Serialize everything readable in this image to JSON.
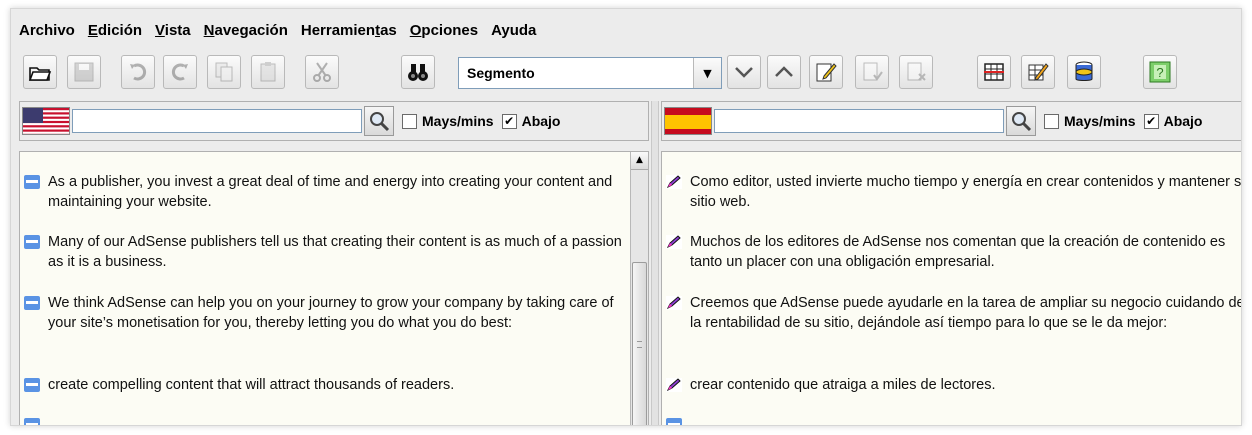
{
  "menu": [
    {
      "label": "Archivo",
      "mnemonic": ""
    },
    {
      "label": "Edición",
      "mnemonic": "E"
    },
    {
      "label": "Vista",
      "mnemonic": "V"
    },
    {
      "label": "Navegación",
      "mnemonic": "N"
    },
    {
      "label": "Herramientas",
      "mnemonic": ""
    },
    {
      "label": "Opciones",
      "mnemonic": "O"
    },
    {
      "label": "Ayuda",
      "mnemonic": ""
    }
  ],
  "toolbar": {
    "segment_select": {
      "value": "Segmento"
    },
    "icons": [
      "open-folder-icon",
      "save-icon",
      "undo-icon",
      "redo-icon",
      "copy-icon",
      "paste-icon",
      "cut-icon",
      "find-binoculars-icon",
      "next-segment-icon",
      "previous-segment-icon",
      "edit-segment-icon",
      "validate-segment-icon",
      "remove-segment-icon",
      "grid-icon",
      "edit-pencil-icon",
      "database-icon",
      "help-icon"
    ]
  },
  "source_pane": {
    "flag": "us-flag-icon",
    "search_value": "",
    "case_label": "Mays/mins",
    "case_checked": false,
    "down_label": "Abajo",
    "down_checked": true,
    "segments": [
      "As a publisher, you invest a great deal of time and energy into creating your content and maintaining your website.",
      "Many of our AdSense publishers tell us that creating their content is as much of a passion as it is a business.",
      "We think AdSense can help you on your journey to grow your company by taking care of your site’s monetisation for you, thereby letting you do what you do best:",
      "create compelling content that will attract thousands of readers."
    ]
  },
  "target_pane": {
    "flag": "spain-flag-icon",
    "search_value": "",
    "case_label": "Mays/mins",
    "case_checked": false,
    "down_label": "Abajo",
    "down_checked": true,
    "segments": [
      "Como editor, usted invierte mucho tiempo y energía en crear contenidos y mantener su sitio web.",
      "Muchos de los editores de AdSense nos comentan que la creación de contenido es tanto un placer con una obligación empresarial.",
      "Creemos que AdSense puede ayudarle en la tarea de ampliar su negocio cuidando de la rentabilidad de su sitio, dejándole así tiempo para lo que se le da mejor:",
      "crear contenido que atraiga a miles de lectores."
    ]
  },
  "colors": {
    "source_marker": "#5a93e4",
    "target_marker": "#8b3fd0",
    "text_bg": "#fcfcf4"
  }
}
